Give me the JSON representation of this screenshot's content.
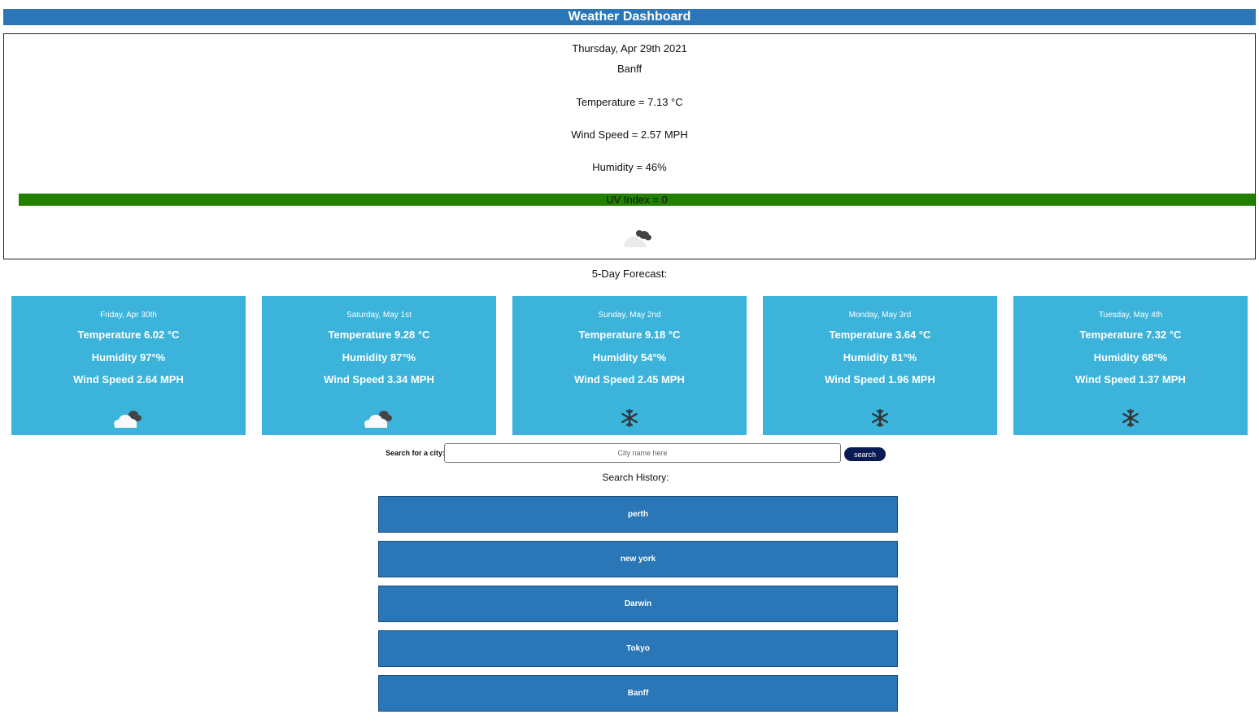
{
  "header": {
    "title": "Weather Dashboard"
  },
  "current": {
    "date": "Thursday, Apr 29th 2021",
    "city": "Banff",
    "temperature": "Temperature = 7.13 °C",
    "wind": "Wind Speed = 2.57 MPH",
    "humidity": "Humidity = 46%",
    "uv": "UV Index = 0",
    "uv_color": "#228000",
    "icon": "cloud-icon"
  },
  "forecast": {
    "title": "5-Day Forecast:",
    "days": [
      {
        "date": "Friday, Apr 30th",
        "temp": "Temperature 6.02 °C",
        "humidity": "Humidity 97°%",
        "wind": "Wind Speed 2.64 MPH",
        "icon": "cloud-icon"
      },
      {
        "date": "Saturday, May 1st",
        "temp": "Temperature 9.28 °C",
        "humidity": "Humidity 87°%",
        "wind": "Wind Speed 3.34 MPH",
        "icon": "cloud-icon"
      },
      {
        "date": "Sunday, May 2nd",
        "temp": "Temperature 9.18 °C",
        "humidity": "Humidity 54°%",
        "wind": "Wind Speed 2.45 MPH",
        "icon": "snowflake-icon"
      },
      {
        "date": "Monday, May 3rd",
        "temp": "Temperature 3.64 °C",
        "humidity": "Humidity 81°%",
        "wind": "Wind Speed 1.96 MPH",
        "icon": "snowflake-icon"
      },
      {
        "date": "Tuesday, May 4th",
        "temp": "Temperature 7.32 °C",
        "humidity": "Humidity 68°%",
        "wind": "Wind Speed 1.37 MPH",
        "icon": "snowflake-icon"
      }
    ]
  },
  "search": {
    "label": "Search for a city:",
    "placeholder": "City name here",
    "button": "search"
  },
  "history": {
    "title": "Search History:",
    "items": [
      "perth",
      "new york",
      "Darwin",
      "Tokyo",
      "Banff"
    ]
  },
  "colors": {
    "header": "#2a76b6",
    "card": "#3bb3da",
    "history_button": "#2a76b6",
    "search_button": "#0a1a55"
  }
}
